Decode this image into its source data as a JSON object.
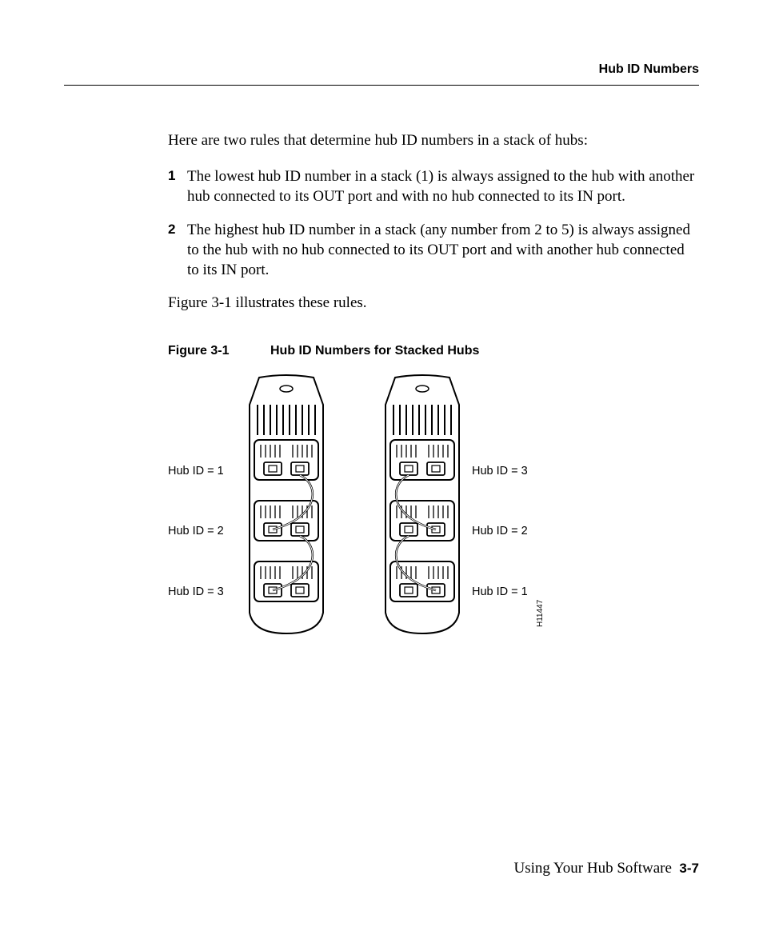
{
  "header": {
    "section_title": "Hub ID Numbers"
  },
  "intro": "Here are two rules that determine hub ID numbers in a stack of hubs:",
  "rules": [
    {
      "n": "1",
      "text": "The lowest hub ID number in a stack (1) is always assigned to the hub with another hub connected to its OUT port and with no hub connected to its IN port."
    },
    {
      "n": "2",
      "text": "The highest hub ID number in a stack (any number from 2 to 5) is always assigned to the hub with no hub connected to its OUT port and with another hub connected to its IN port."
    }
  ],
  "figure_ref": "Figure 3-1 illustrates these rules.",
  "figure": {
    "number": "Figure 3-1",
    "title": "Hub ID Numbers for Stacked Hubs",
    "labels_left": [
      "Hub ID = 1",
      "Hub ID = 2",
      "Hub ID = 3"
    ],
    "labels_right": [
      "Hub ID = 3",
      "Hub ID = 2",
      "Hub ID = 1"
    ],
    "image_code": "H11447"
  },
  "footer": {
    "chapter": "Using Your Hub Software",
    "page": "3-7"
  }
}
